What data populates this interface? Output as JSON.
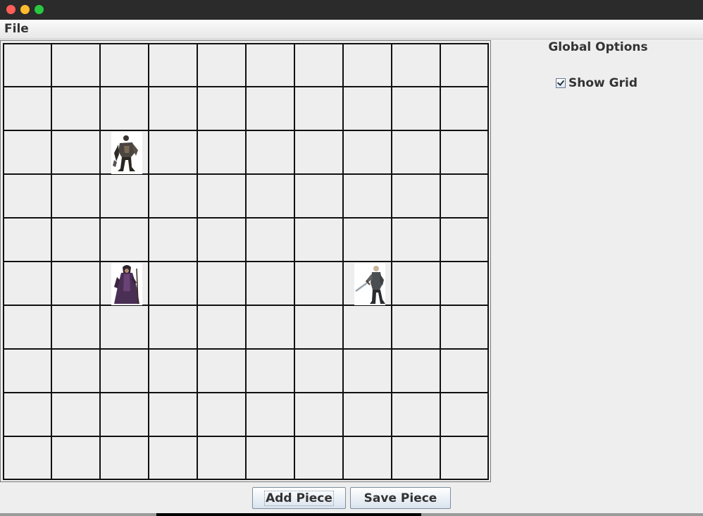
{
  "menubar": {
    "items": [
      "File"
    ]
  },
  "board": {
    "rows": 10,
    "cols": 10,
    "pieces": [
      {
        "name": "armored-warrior",
        "row": 2,
        "col": 2
      },
      {
        "name": "hooded-sorcerer",
        "row": 5,
        "col": 2
      },
      {
        "name": "sword-knight",
        "row": 5,
        "col": 7
      }
    ]
  },
  "options": {
    "title": "Global Options",
    "show_grid_label": "Show Grid",
    "show_grid_checked": true
  },
  "buttons": {
    "add_piece": "Add Piece",
    "save_piece": "Save Piece"
  },
  "colors": {
    "background": "#eeeeee",
    "grid_line": "#111111",
    "titlebar": "#2b2b2b",
    "close": "#ff5f57",
    "minimize": "#febc2e",
    "maximize": "#28c840"
  }
}
